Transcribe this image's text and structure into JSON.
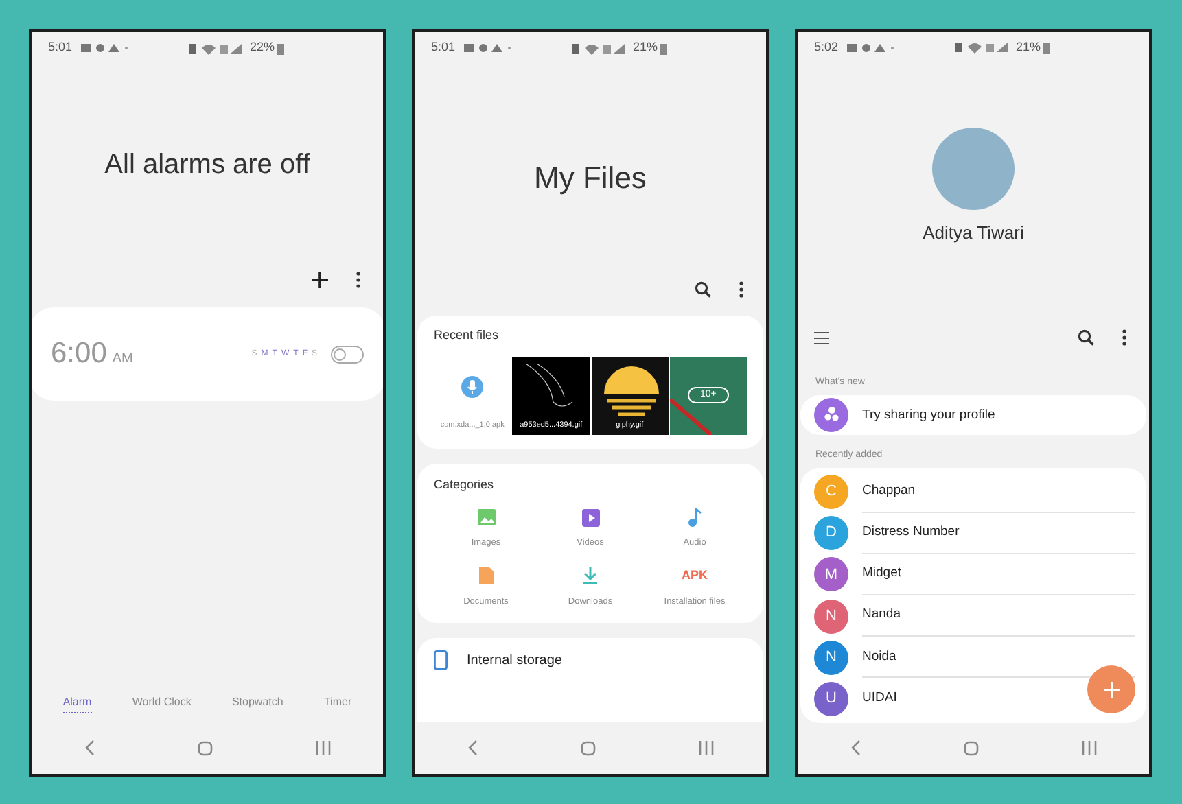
{
  "alarm_screen": {
    "status_bar": {
      "time": "5:01",
      "battery": "22%"
    },
    "title": "All alarms are off",
    "alarm": {
      "time": "6:00",
      "period": "AM",
      "on": false,
      "days": [
        {
          "label": "S",
          "active": false
        },
        {
          "label": "M",
          "active": true
        },
        {
          "label": "T",
          "active": true
        },
        {
          "label": "W",
          "active": true
        },
        {
          "label": "T",
          "active": true
        },
        {
          "label": "F",
          "active": true
        },
        {
          "label": "S",
          "active": false
        }
      ]
    },
    "tabs": [
      {
        "label": "Alarm",
        "selected": true
      },
      {
        "label": "World Clock",
        "selected": false
      },
      {
        "label": "Stopwatch",
        "selected": false
      },
      {
        "label": "Timer",
        "selected": false
      }
    ]
  },
  "files_screen": {
    "status_bar": {
      "time": "5:01",
      "battery": "21%"
    },
    "title": "My Files",
    "recent_files": {
      "heading": "Recent files",
      "items": [
        {
          "kind": "apk",
          "name": "com.xda..._1.0.apk"
        },
        {
          "kind": "sketch",
          "name": "a953ed5...4394.gif"
        },
        {
          "kind": "sunset",
          "name": "giphy.gif"
        },
        {
          "kind": "more",
          "badge": "10+"
        }
      ]
    },
    "categories": {
      "heading": "Categories",
      "items": [
        {
          "kind": "images",
          "label": "Images"
        },
        {
          "kind": "videos",
          "label": "Videos"
        },
        {
          "kind": "audio",
          "label": "Audio"
        },
        {
          "kind": "documents",
          "label": "Documents"
        },
        {
          "kind": "downloads",
          "label": "Downloads"
        },
        {
          "kind": "apk",
          "label": "Installation files",
          "icon_text": "APK"
        }
      ]
    },
    "storage": {
      "label": "Internal storage"
    }
  },
  "contacts_screen": {
    "status_bar": {
      "time": "5:02",
      "battery": "21%"
    },
    "profile_name": "Aditya Tiwari",
    "whats_new": {
      "heading": "What's new",
      "item": "Try sharing your profile"
    },
    "recently_added": {
      "heading": "Recently added",
      "contacts": [
        {
          "initial": "C",
          "name": "Chappan",
          "color": "#f5a623"
        },
        {
          "initial": "D",
          "name": "Distress Number",
          "color": "#2ba3dc"
        },
        {
          "initial": "M",
          "name": "Midget",
          "color": "#a55fc8"
        },
        {
          "initial": "N",
          "name": "Nanda",
          "color": "#de6476"
        },
        {
          "initial": "N",
          "name": "Noida",
          "color": "#1e88d6"
        },
        {
          "initial": "U",
          "name": "UIDAI",
          "color": "#7a62cb"
        }
      ]
    }
  }
}
